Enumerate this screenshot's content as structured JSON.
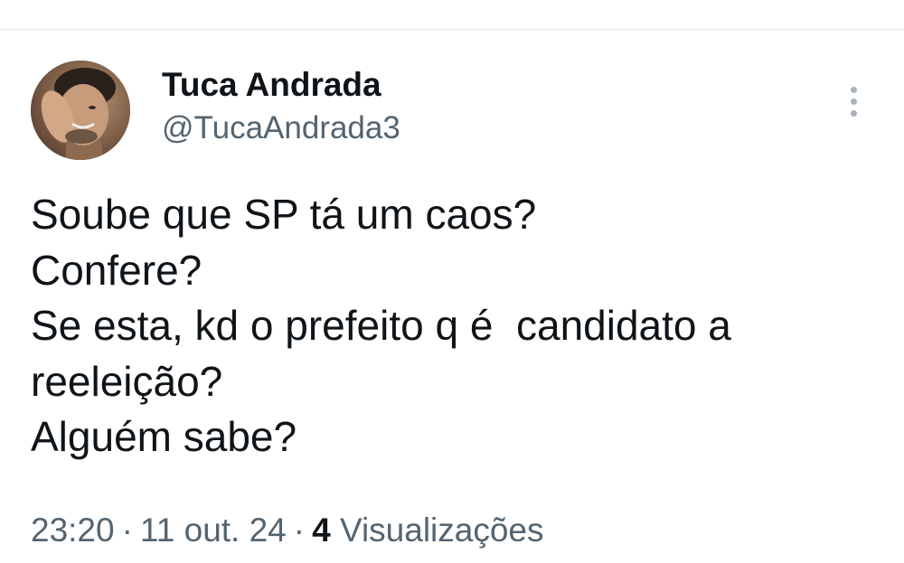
{
  "tweet": {
    "author": {
      "display_name": "Tuca Andrada",
      "handle": "@TucaAndrada3",
      "avatar_icon": "profile-photo"
    },
    "more_icon": "more-vertical-icon",
    "text_lines": [
      "Soube que SP tá um caos?",
      "Confere?",
      "Se esta, kd o prefeito q é  candidato a",
      "reeleição?",
      "Alguém sabe?"
    ],
    "meta": {
      "time": "23:20",
      "separator": "·",
      "date": "11 out. 24",
      "views_count": "4",
      "views_label": "Visualizações"
    }
  },
  "colors": {
    "text_primary": "#0f1419",
    "text_secondary": "#536471",
    "divider": "#e6e9eb"
  }
}
